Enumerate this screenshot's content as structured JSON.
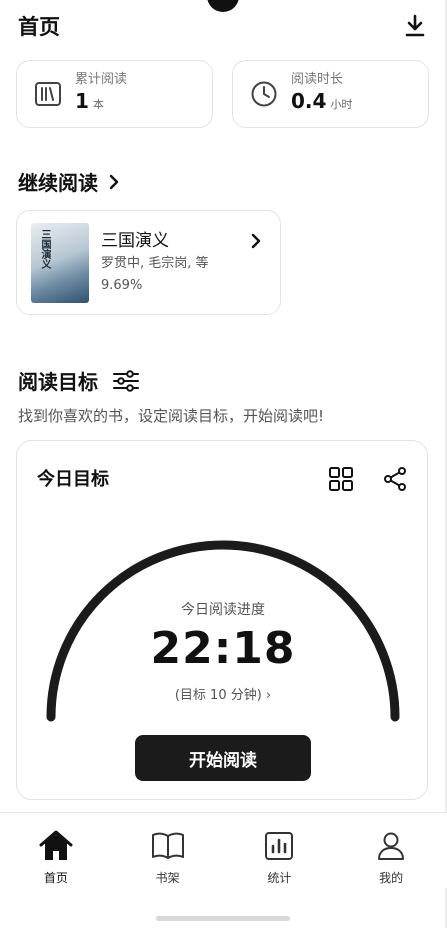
{
  "header": {
    "title": "首页"
  },
  "stats": {
    "total_books": {
      "label": "累计阅读",
      "value": "1",
      "unit": "本"
    },
    "reading_time": {
      "label": "阅读时长",
      "value": "0.4",
      "unit": "小时"
    }
  },
  "continue_reading": {
    "title": "继续阅读",
    "book": {
      "cover_text": "三国演义",
      "title": "三国演义",
      "authors": "罗贯中, 毛宗岗, 等",
      "progress": "9.69%"
    }
  },
  "reading_goal": {
    "title": "阅读目标",
    "hint": "找到你喜欢的书，设定阅读目标，开始阅读吧!",
    "card": {
      "title": "今日目标",
      "progress_label": "今日阅读进度",
      "progress_time": "22:18",
      "target_text": "(目标 10 分钟) ›",
      "start_button": "开始阅读"
    }
  },
  "nav": {
    "items": [
      {
        "label": "首页",
        "icon": "home-icon",
        "active": true
      },
      {
        "label": "书架",
        "icon": "book-open-icon",
        "active": false
      },
      {
        "label": "统计",
        "icon": "bar-chart-icon",
        "active": false
      },
      {
        "label": "我的",
        "icon": "user-icon",
        "active": false
      }
    ]
  },
  "colors": {
    "accent": "#1b1b1b",
    "border": "#e3e3e3",
    "text": "#111111"
  }
}
